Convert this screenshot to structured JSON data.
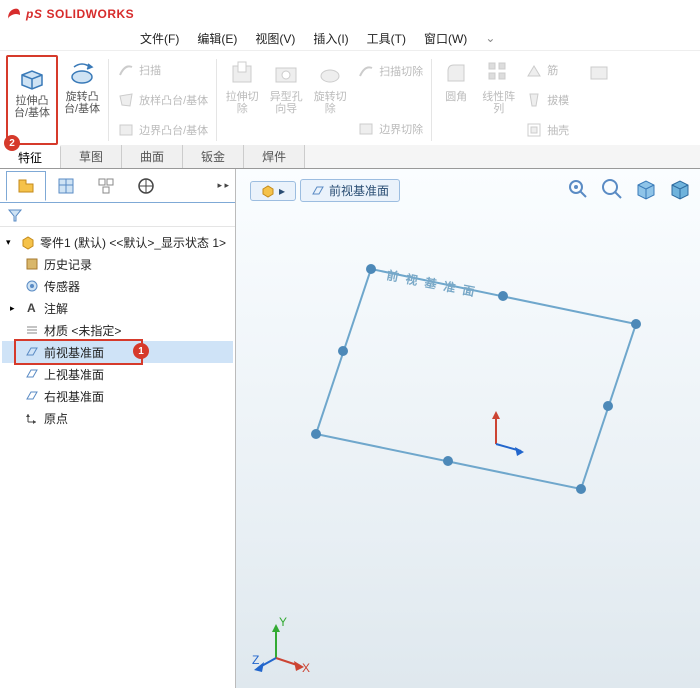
{
  "brand": "SOLIDWORKS",
  "menu": {
    "file": "文件(F)",
    "edit": "编辑(E)",
    "view": "视图(V)",
    "insert": "插入(I)",
    "tools": "工具(T)",
    "window": "窗口(W)"
  },
  "ribbon": {
    "extrude_boss": "拉伸凸\n台/基体",
    "revolve_boss": "旋转凸\n台/基体",
    "sweep": "扫描",
    "loft": "放样凸台/基体",
    "boundary": "边界凸台/基体",
    "extrude_cut": "拉伸切\n除",
    "hole_wizard": "异型孔\n向导",
    "revolve_cut": "旋转切\n除",
    "sweep_cut": "扫描切除",
    "boundary_cut": "边界切除",
    "fillet": "圆角",
    "linear_pattern": "线性阵\n列",
    "rib": "筋",
    "draft": "拔模",
    "shell": "抽壳"
  },
  "tabs": {
    "features": "特征",
    "sketch": "草图",
    "surfaces": "曲面",
    "sheetmetal": "钣金",
    "weldments": "焊件"
  },
  "tree": {
    "root": "零件1 (默认) <<默认>_显示状态 1>",
    "history": "历史记录",
    "sensors": "传感器",
    "annotations": "注解",
    "material": "材质 <未指定>",
    "front_plane": "前视基准面",
    "top_plane": "上视基准面",
    "right_plane": "右视基准面",
    "origin": "原点"
  },
  "viewport": {
    "breadcrumb": "前视基准面",
    "plane_label": "前 视 基 准 面"
  },
  "callouts": {
    "extrude": "2",
    "front_plane": "1"
  }
}
